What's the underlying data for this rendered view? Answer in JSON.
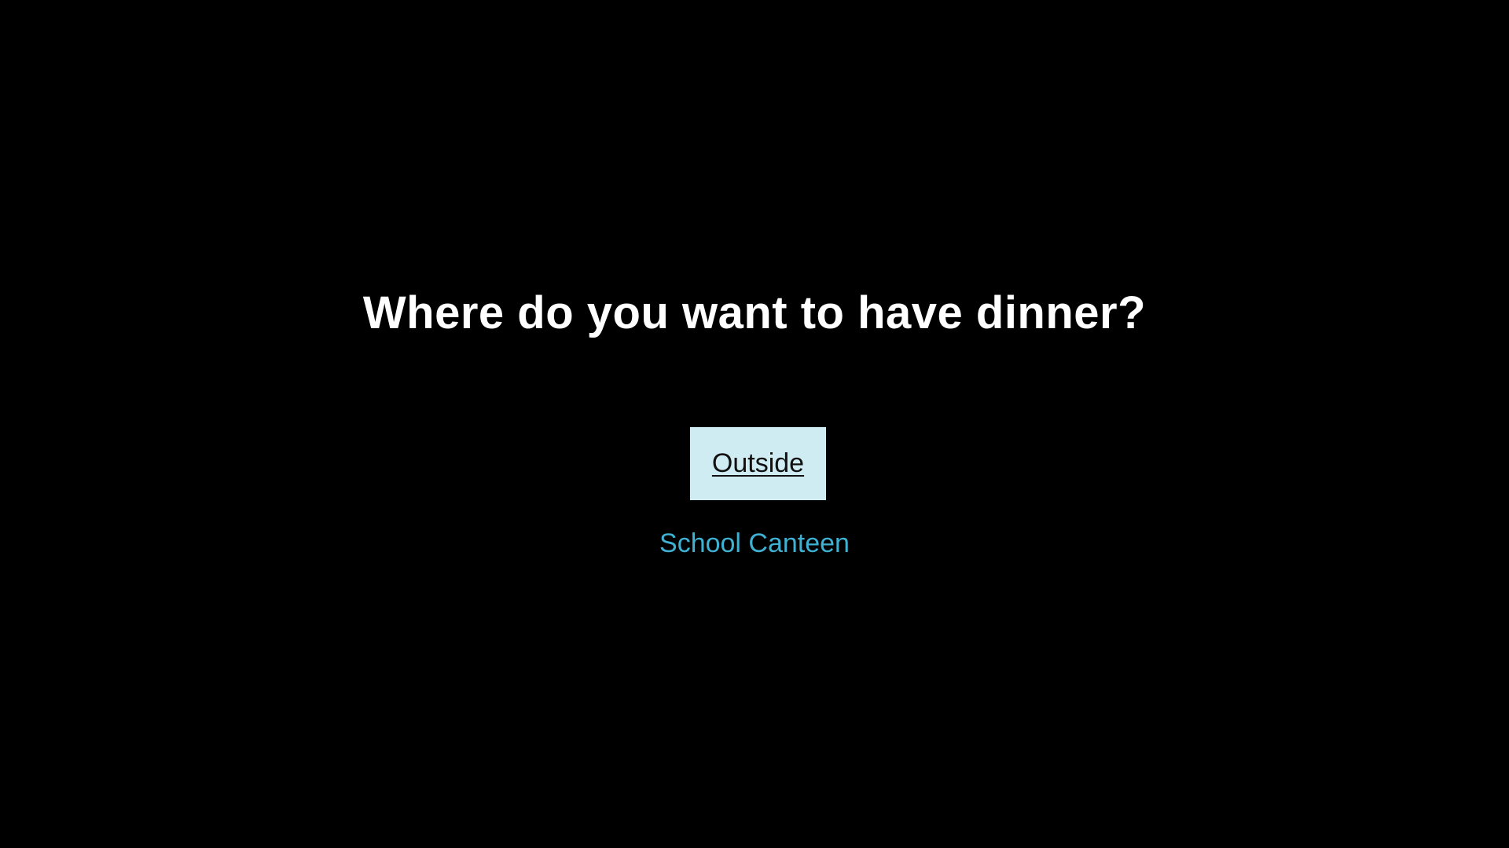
{
  "prompt": {
    "question": "Where do you want to have dinner?"
  },
  "choices": [
    {
      "label": "Outside",
      "state": "highlighted"
    },
    {
      "label": "School Canteen",
      "state": "normal"
    }
  ],
  "colors": {
    "background": "#000000",
    "question_text": "#ffffff",
    "highlight_bg": "#cfecf3",
    "highlight_text": "#111111",
    "choice_text": "#3fb1d2"
  }
}
